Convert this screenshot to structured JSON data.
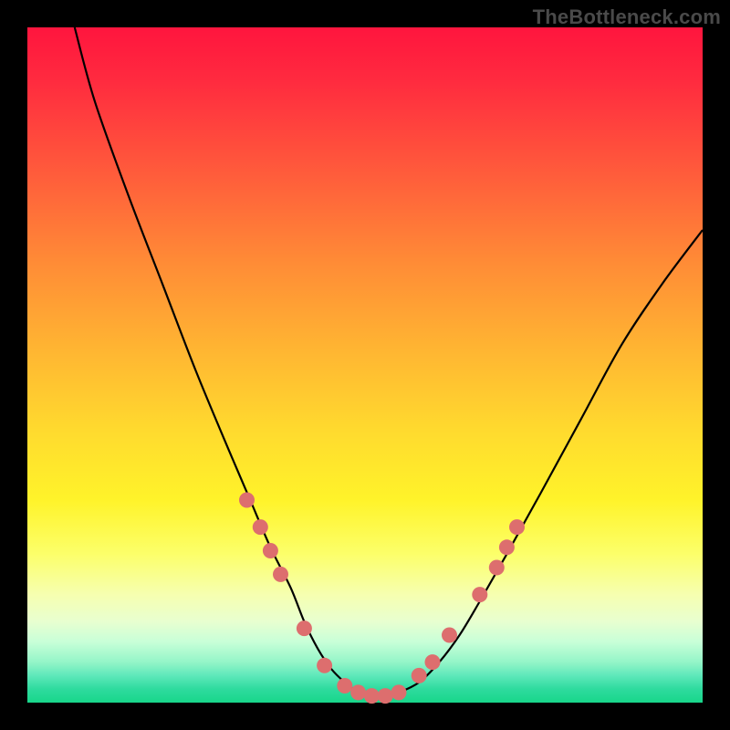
{
  "watermark": "TheBottleneck.com",
  "chart_data": {
    "type": "line",
    "title": "",
    "xlabel": "",
    "ylabel": "",
    "xlim": [
      0,
      100
    ],
    "ylim": [
      0,
      100
    ],
    "series": [
      {
        "name": "curve",
        "x": [
          7,
          10,
          15,
          20,
          25,
          30,
          33,
          36,
          39,
          41,
          43,
          45,
          47,
          49,
          51,
          53,
          55,
          58,
          61,
          64,
          67,
          71,
          76,
          82,
          88,
          94,
          100
        ],
        "values": [
          100,
          89,
          75,
          62,
          49,
          37,
          30,
          23,
          17,
          12,
          8,
          5,
          3,
          1.5,
          1,
          1,
          1.5,
          3,
          6,
          10,
          15,
          22,
          31,
          42,
          53,
          62,
          70
        ]
      }
    ],
    "markers": {
      "left_branch": [
        {
          "x": 32.5,
          "y": 30
        },
        {
          "x": 34.5,
          "y": 26
        },
        {
          "x": 36.0,
          "y": 22.5
        },
        {
          "x": 37.5,
          "y": 19
        },
        {
          "x": 41.0,
          "y": 11
        },
        {
          "x": 44.0,
          "y": 5.5
        }
      ],
      "valley": [
        {
          "x": 47.0,
          "y": 2.5
        },
        {
          "x": 49.0,
          "y": 1.5
        },
        {
          "x": 51.0,
          "y": 1.0
        },
        {
          "x": 53.0,
          "y": 1.0
        },
        {
          "x": 55.0,
          "y": 1.5
        }
      ],
      "right_branch": [
        {
          "x": 58.0,
          "y": 4
        },
        {
          "x": 60.0,
          "y": 6
        },
        {
          "x": 62.5,
          "y": 10
        },
        {
          "x": 67.0,
          "y": 16
        },
        {
          "x": 69.5,
          "y": 20
        },
        {
          "x": 71.0,
          "y": 23
        },
        {
          "x": 72.5,
          "y": 26
        }
      ]
    },
    "colors": {
      "curve": "#000000",
      "marker_fill": "#dd6e6e",
      "marker_stroke": "#d85f5f"
    }
  }
}
